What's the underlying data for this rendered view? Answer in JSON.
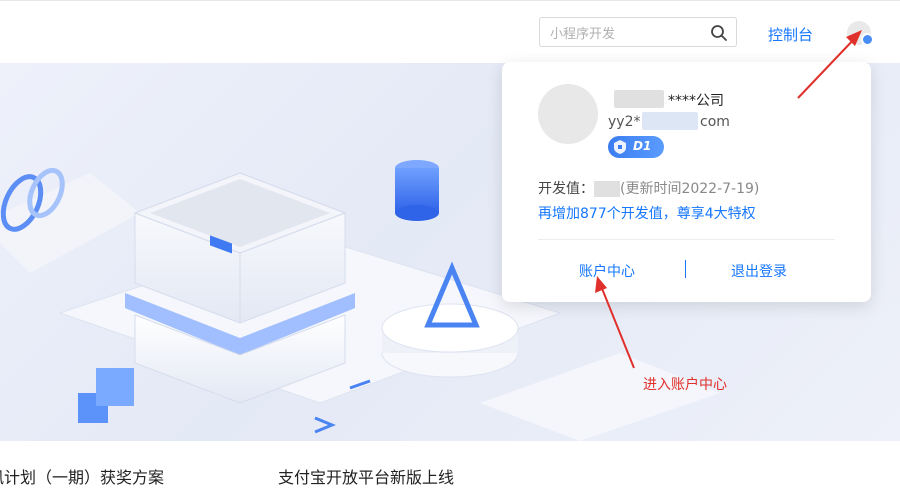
{
  "header": {
    "search_placeholder": "小程序开发",
    "console_label": "控制台"
  },
  "profile_menu": {
    "company_suffix": "****公司",
    "email_prefix": "yy2*",
    "email_suffix": "com",
    "level_badge": "D1",
    "dev_value_label": "开发值：",
    "dev_value_update": "(更新时间2022-7-19)",
    "upgrade_hint": "再增加877个开发值，尊享4大特权",
    "account_center_label": "账户中心",
    "logout_label": "退出登录"
  },
  "annotation": {
    "text": "进入账户中心",
    "color": "#e0302b"
  },
  "news": [
    {
      "title": "凤计划（一期）获奖方案"
    },
    {
      "title": "支付宝开放平台新版上线"
    }
  ],
  "colors": {
    "accent": "#1677ff",
    "annotation": "#e0302b",
    "badge": "#3b7cf0"
  }
}
